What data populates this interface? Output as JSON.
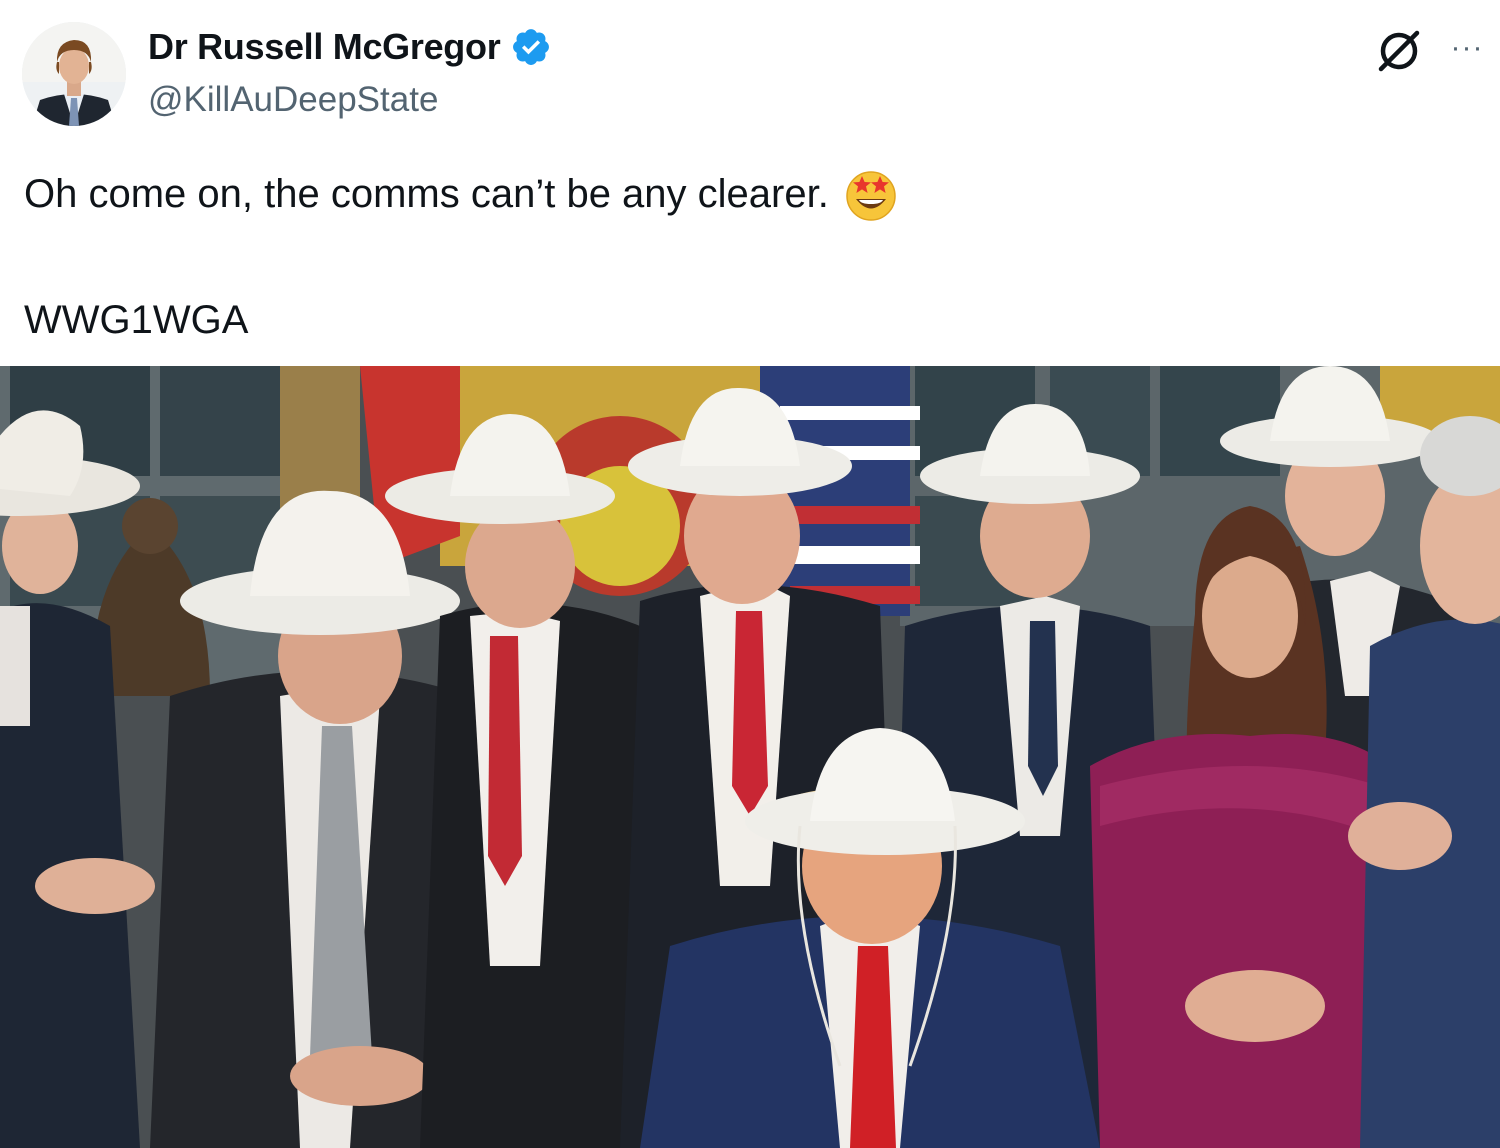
{
  "author": {
    "display_name": "Dr Russell McGregor",
    "handle": "@KillAuDeepState",
    "verified": true,
    "verified_color": "#1d9bf0"
  },
  "icons": {
    "verified": "verified-badge-icon",
    "grok": "grok-icon",
    "more": "more-options-icon",
    "emoji": "star-struck-emoji"
  },
  "more_glyph": "···",
  "tweet": {
    "line1": "Oh come on, the comms can’t be any clearer.",
    "line2": "WWG1WGA"
  },
  "media": {
    "type": "photo",
    "alt": ""
  },
  "colors": {
    "text_primary": "#0f1419",
    "text_secondary": "#536471",
    "accent": "#1d9bf0"
  }
}
